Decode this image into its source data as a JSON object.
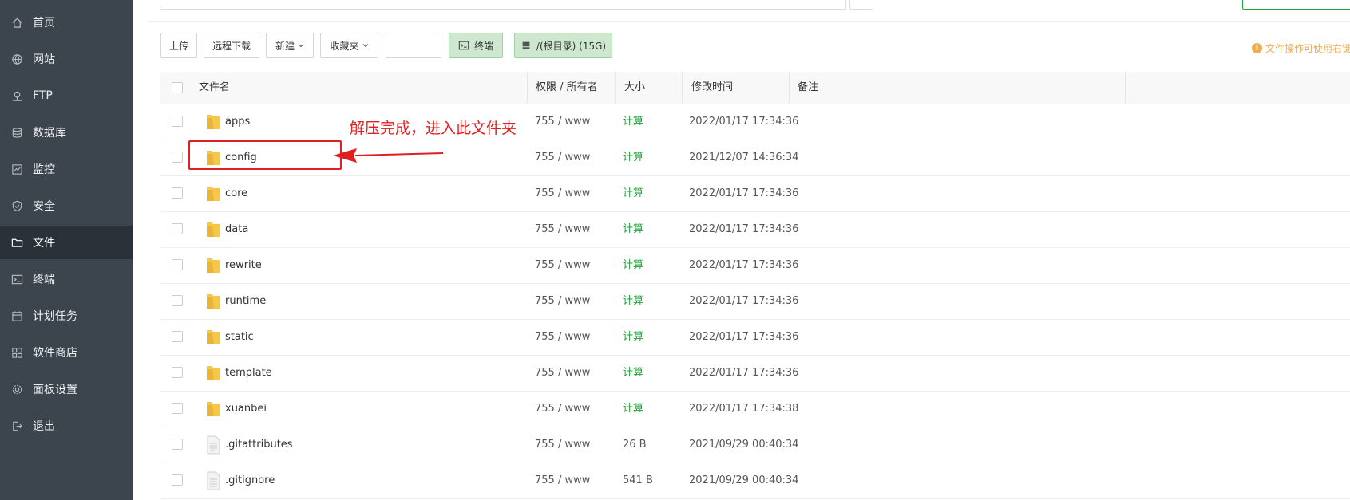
{
  "sidebar": {
    "items": [
      {
        "label": "首页",
        "icon": "home-icon"
      },
      {
        "label": "网站",
        "icon": "globe-icon"
      },
      {
        "label": "FTP",
        "icon": "ftp-icon"
      },
      {
        "label": "数据库",
        "icon": "database-icon"
      },
      {
        "label": "监控",
        "icon": "monitor-icon"
      },
      {
        "label": "安全",
        "icon": "shield-icon"
      },
      {
        "label": "文件",
        "icon": "folder-icon",
        "active": true
      },
      {
        "label": "终端",
        "icon": "terminal-icon"
      },
      {
        "label": "计划任务",
        "icon": "calendar-icon"
      },
      {
        "label": "软件商店",
        "icon": "apps-icon"
      },
      {
        "label": "面板设置",
        "icon": "gear-icon"
      },
      {
        "label": "退出",
        "icon": "logout-icon"
      }
    ]
  },
  "toolbar": {
    "upload": "上传",
    "remote_download": "远程下载",
    "new": "新建",
    "favorites": "收藏夹",
    "terminal": "终端",
    "disk": "/(根目录) (15G)"
  },
  "tip": "文件操作可使用右键",
  "table": {
    "headers": {
      "name": "文件名",
      "perm": "权限 / 所有者",
      "size": "大小",
      "mtime": "修改时间",
      "note": "备注"
    },
    "rows": [
      {
        "name": "apps",
        "type": "folder",
        "perm": "755 / www",
        "size": "计算",
        "mtime": "2022/01/17 17:34:36"
      },
      {
        "name": "config",
        "type": "folder",
        "perm": "755 / www",
        "size": "计算",
        "mtime": "2021/12/07 14:36:34"
      },
      {
        "name": "core",
        "type": "folder",
        "perm": "755 / www",
        "size": "计算",
        "mtime": "2022/01/17 17:34:36"
      },
      {
        "name": "data",
        "type": "folder",
        "perm": "755 / www",
        "size": "计算",
        "mtime": "2022/01/17 17:34:36"
      },
      {
        "name": "rewrite",
        "type": "folder",
        "perm": "755 / www",
        "size": "计算",
        "mtime": "2022/01/17 17:34:36"
      },
      {
        "name": "runtime",
        "type": "folder",
        "perm": "755 / www",
        "size": "计算",
        "mtime": "2022/01/17 17:34:36"
      },
      {
        "name": "static",
        "type": "folder",
        "perm": "755 / www",
        "size": "计算",
        "mtime": "2022/01/17 17:34:36"
      },
      {
        "name": "template",
        "type": "folder",
        "perm": "755 / www",
        "size": "计算",
        "mtime": "2022/01/17 17:34:36"
      },
      {
        "name": "xuanbei",
        "type": "folder",
        "perm": "755 / www",
        "size": "计算",
        "mtime": "2022/01/17 17:34:38"
      },
      {
        "name": ".gitattributes",
        "type": "file",
        "perm": "755 / www",
        "size": "26 B",
        "mtime": "2021/09/29 00:40:34"
      },
      {
        "name": ".gitignore",
        "type": "file",
        "perm": "755 / www",
        "size": "541 B",
        "mtime": "2021/09/29 00:40:34"
      }
    ]
  },
  "annotation": {
    "text": "解压完成，进入此文件夹",
    "color": "#e02020"
  },
  "colors": {
    "sidebar_bg": "#3c444d",
    "sidebar_active": "#2b3138",
    "accent_green": "#20a53a",
    "folder_yellow": "#f5c84c",
    "tip_orange": "#f0ad4e"
  }
}
